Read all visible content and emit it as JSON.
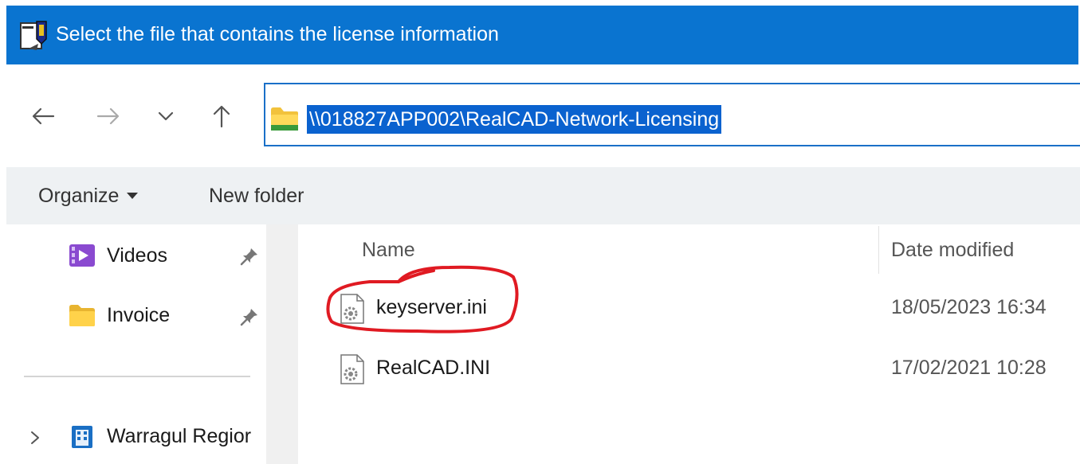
{
  "window": {
    "title": "Select the file that contains the license information",
    "accent_color": "#0a74d0"
  },
  "navigation": {
    "back_icon": "arrow-left-icon",
    "forward_icon": "arrow-right-icon",
    "recent_icon": "chevron-down-icon",
    "up_icon": "arrow-up-icon"
  },
  "address_bar": {
    "path": "\\\\018827APP002\\RealCAD-Network-Licensing",
    "icon": "folder-icon",
    "selected": true
  },
  "toolbar": {
    "organize_label": "Organize",
    "new_folder_label": "New folder"
  },
  "nav_pane": {
    "quick_access": [
      {
        "label": "Videos",
        "icon": "videos-icon",
        "pinned": true
      },
      {
        "label": "Invoice",
        "icon": "folder-icon",
        "pinned": true
      }
    ],
    "locations": [
      {
        "label": "Warragul Regior",
        "icon": "building-icon",
        "expandable": true
      }
    ]
  },
  "file_list": {
    "columns": [
      "Name",
      "Date modified"
    ],
    "files": [
      {
        "name": "keyserver.ini",
        "date_modified": "18/05/2023 16:34",
        "icon": "config-file-icon",
        "annotated": true
      },
      {
        "name": "RealCAD.INI",
        "date_modified": "17/02/2021 10:28",
        "icon": "config-file-icon",
        "annotated": false
      }
    ]
  },
  "annotation": {
    "color": "#e01a22",
    "shape": "freehand-ring"
  }
}
